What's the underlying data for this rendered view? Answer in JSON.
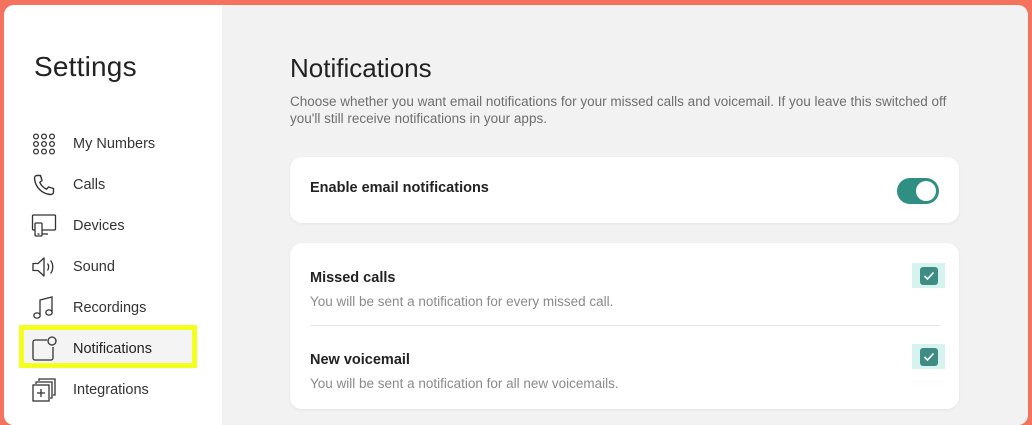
{
  "sidebar": {
    "title": "Settings",
    "items": [
      {
        "label": "My Numbers",
        "icon": "dialpad-icon"
      },
      {
        "label": "Calls",
        "icon": "phone-icon"
      },
      {
        "label": "Devices",
        "icon": "devices-icon"
      },
      {
        "label": "Sound",
        "icon": "speaker-icon"
      },
      {
        "label": "Recordings",
        "icon": "music-note-icon"
      },
      {
        "label": "Notifications",
        "icon": "notification-icon",
        "active": true
      },
      {
        "label": "Integrations",
        "icon": "integrations-icon"
      }
    ]
  },
  "main": {
    "title": "Notifications",
    "description": "Choose whether you want email notifications for your missed calls and voicemail. If you leave this switched off you'll still receive notifications in your apps.",
    "email_toggle": {
      "label": "Enable email notifications",
      "enabled": true
    },
    "options": [
      {
        "title": "Missed calls",
        "subtitle": "You will be sent a notification for every missed call.",
        "checked": true
      },
      {
        "title": "New voicemail",
        "subtitle": "You will be sent a notification for all new voicemails.",
        "checked": true
      }
    ]
  },
  "colors": {
    "background": "#f4725e",
    "accent": "#2f8f83",
    "highlight": "#f3ff1f"
  }
}
